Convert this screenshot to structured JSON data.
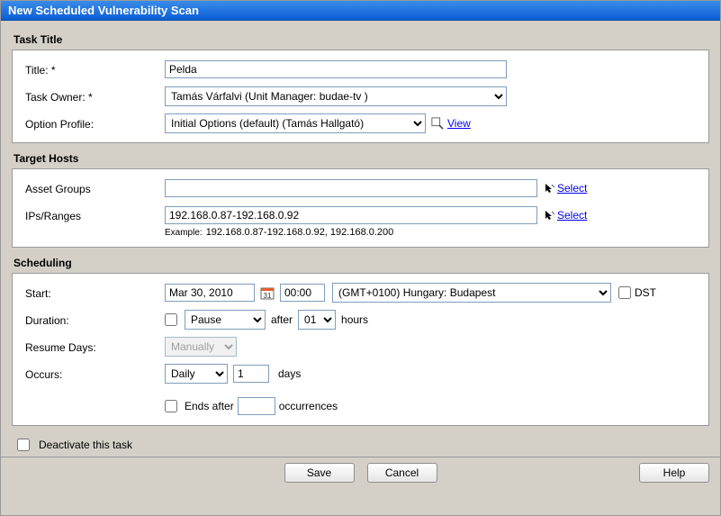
{
  "window": {
    "title": "New Scheduled Vulnerability Scan"
  },
  "sections": {
    "task_title": {
      "heading": "Task Title",
      "title_label": "Title: *",
      "title_value": "Pelda",
      "owner_label": "Task Owner: *",
      "owner_value": "Tamás Várfalvi (Unit Manager: budae-tv )",
      "profile_label": "Option Profile:",
      "profile_value": "Initial Options (default) (Tamás Hallgató)",
      "view_link": "View"
    },
    "target_hosts": {
      "heading": "Target Hosts",
      "asset_label": "Asset Groups",
      "asset_value": "",
      "ips_label": "IPs/Ranges",
      "ips_value": "192.168.0.87-192.168.0.92",
      "example_label": "Example:",
      "example_text": "192.168.0.87-192.168.0.92, 192.168.0.200",
      "select_link": "Select"
    },
    "scheduling": {
      "heading": "Scheduling",
      "start_label": "Start:",
      "start_date": "Mar 30, 2010",
      "start_time": "00:00",
      "timezone": "(GMT+0100) Hungary: Budapest",
      "dst_label": "DST",
      "duration_label": "Duration:",
      "pause_value": "Pause",
      "after_text": "after",
      "hours_value": "01",
      "hours_text": "hours",
      "resume_label": "Resume Days:",
      "resume_value": "Manually",
      "occurs_label": "Occurs:",
      "occurs_value": "Daily",
      "occurs_num": "1",
      "days_text": "days",
      "ends_after_text": "Ends after",
      "occurrences_text": "occurrences",
      "ends_after_value": ""
    }
  },
  "footer": {
    "deactivate_label": "Deactivate this task"
  },
  "buttons": {
    "save": "Save",
    "cancel": "Cancel",
    "help": "Help"
  }
}
